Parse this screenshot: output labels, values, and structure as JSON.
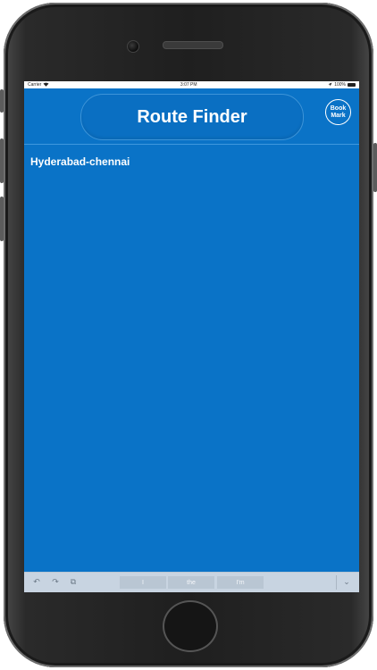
{
  "status_bar": {
    "carrier": "Carrier",
    "time": "3:07 PM",
    "battery": "100%",
    "wifi_icon": "wifi-icon",
    "location_icon": "location-arrow-icon"
  },
  "nav": {
    "title": "Route Finder",
    "bookmark_line1": "Book",
    "bookmark_line2": "Mark"
  },
  "routes": [
    {
      "label": "Hyderabad-chennai"
    }
  ],
  "keyboard_bar": {
    "undo_icon": "↶",
    "redo_icon": "↷",
    "paste_icon": "⧉",
    "suggestions": [
      "I",
      "the",
      "I'm"
    ],
    "dismiss_icon": "⌄"
  },
  "colors": {
    "app_blue": "#0a73c7",
    "keyboard_bar": "#c8d4e1"
  }
}
